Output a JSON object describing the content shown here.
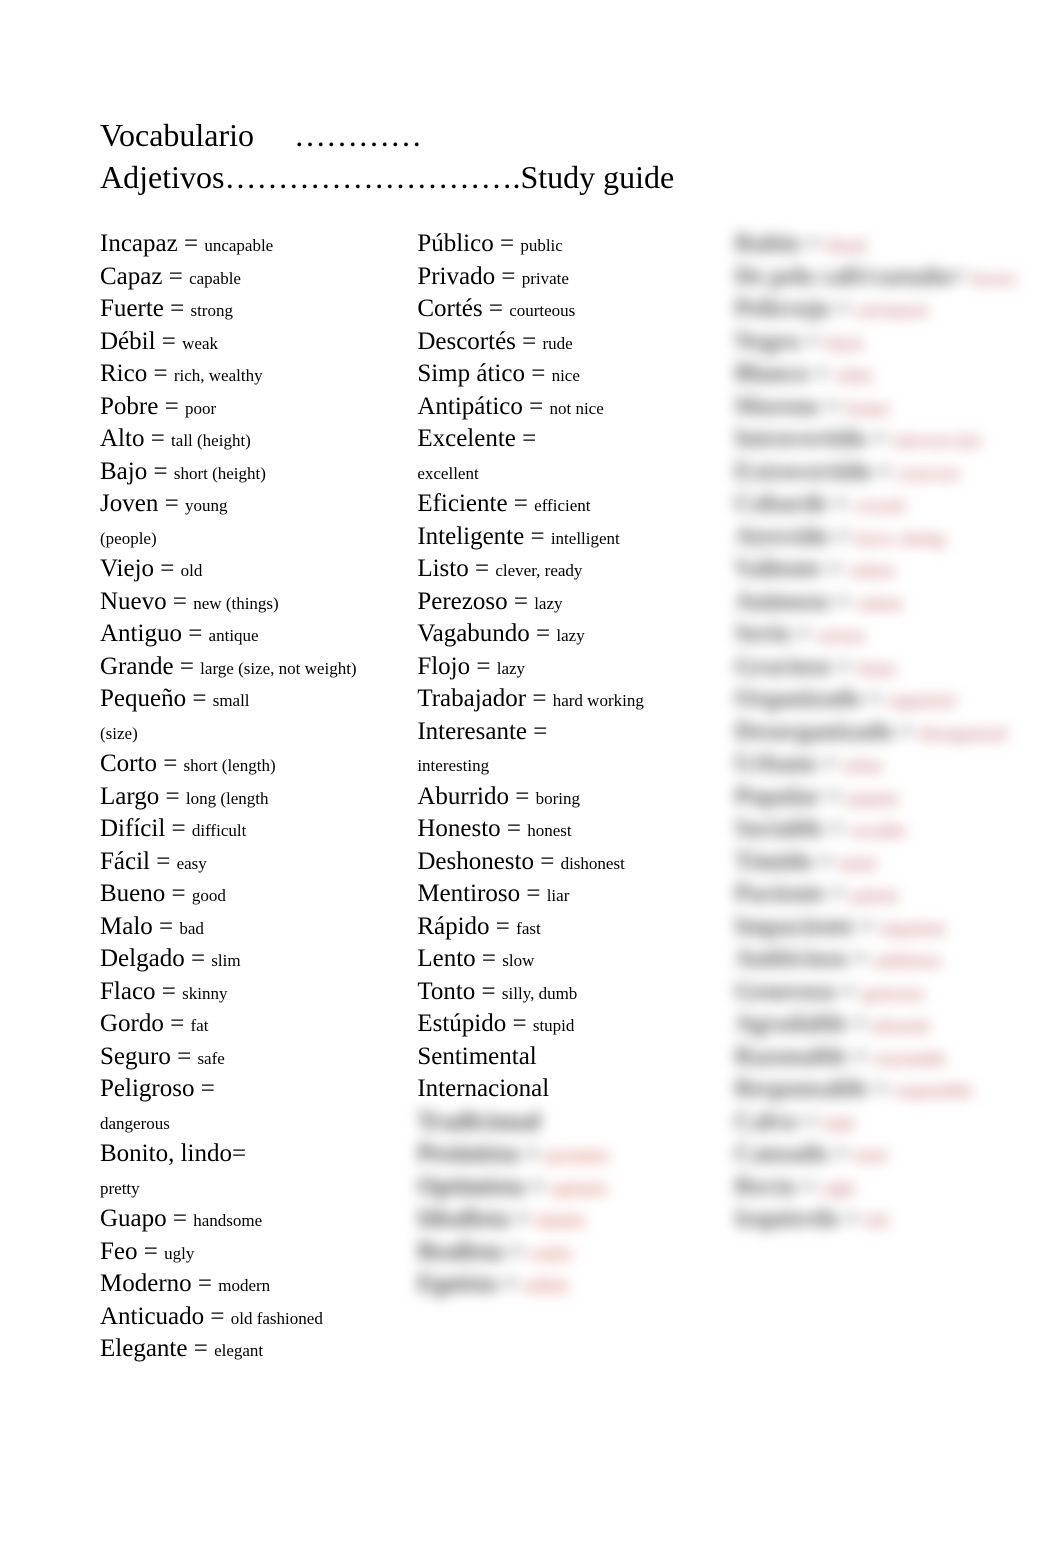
{
  "header": {
    "line1": "Vocabulario     …………",
    "line2": "Adjetivos……………………….Study guide"
  },
  "col1": [
    {
      "term": "Incapaz = ",
      "def": "uncapable"
    },
    {
      "term": "Capaz = ",
      "def": "capable"
    },
    {
      "term": "Fuerte = ",
      "def": "strong"
    },
    {
      "term": "Débil = ",
      "def": "weak"
    },
    {
      "term": "Rico = ",
      "def": "rich, wealthy"
    },
    {
      "term": "Pobre = ",
      "def": "poor"
    },
    {
      "term": "Alto = ",
      "def": "tall",
      "note": "   (height)"
    },
    {
      "term": "Bajo = ",
      "def": "short",
      "note": "   (height)"
    },
    {
      "term": "Joven = ",
      "def": "young",
      "note2": "(people)"
    },
    {
      "term": "Viejo = ",
      "def": "old"
    },
    {
      "term": "Nuevo = ",
      "def": "new",
      "note": "   (things)"
    },
    {
      "term": "Antiguo = ",
      "def": "antique"
    },
    {
      "term": "Grande = ",
      "def": "large",
      "note": "   (size, not weight)"
    },
    {
      "term": "Pequeño = ",
      "def": "small",
      "note2": "(size)"
    },
    {
      "term": "Corto = ",
      "def": "short (length)"
    },
    {
      "term": "Largo = ",
      "def": "long (length"
    },
    {
      "term": "Difícil = ",
      "def": "difficult"
    },
    {
      "term": "Fácil = ",
      "def": "easy"
    },
    {
      "term": "Bueno = ",
      "def": "good"
    },
    {
      "term": "Malo = ",
      "def": "bad"
    },
    {
      "term": "Delgado = ",
      "def": "slim"
    },
    {
      "term": "Flaco = ",
      "def": "skinny"
    },
    {
      "term": "Gordo = ",
      "def": "fat"
    },
    {
      "term": "Seguro = ",
      "def": "safe"
    },
    {
      "term": "Peligroso = ",
      "def": "",
      "note2": "dangerous"
    },
    {
      "term": "Bonito, lindo= ",
      "def": "",
      "note2": "pretty"
    },
    {
      "term": "Guapo = ",
      "def": "handsome"
    },
    {
      "term": "Feo = ",
      "def": "ugly"
    },
    {
      "term": "Moderno = ",
      "def": "modern"
    },
    {
      "term": "Anticuado = ",
      "def": "old fashioned"
    },
    {
      "term": "Elegante = ",
      "def": "elegant"
    }
  ],
  "col2_visible": [
    {
      "term": "Público = ",
      "def": "public"
    },
    {
      "term": "Privado = ",
      "def": "private"
    },
    {
      "term": "Cortés = ",
      "def": "courteous"
    },
    {
      "term": "Descortés = ",
      "def": "rude"
    },
    {
      "term": "Simp  ático = ",
      "def": "nice"
    },
    {
      "term": "Antipático = ",
      "def": "not nice"
    },
    {
      "term": "Excelente = ",
      "def": "",
      "note2": "excellent"
    },
    {
      "term": "Eficiente = ",
      "def": "efficient"
    },
    {
      "term": "Inteligente = ",
      "def": "intelligent"
    },
    {
      "term": "Listo = ",
      "def": "clever, ready"
    },
    {
      "term": "Perezoso = ",
      "def": "lazy"
    },
    {
      "term": "Vagabundo = ",
      "def": "lazy"
    },
    {
      "term": "Flojo = ",
      "def": "lazy"
    },
    {
      "term": "Trabajador = ",
      "def": "hard working"
    },
    {
      "term": "Interesante = ",
      "def": "",
      "note2": "interesting"
    },
    {
      "term": "Aburrido = ",
      "def": "boring"
    },
    {
      "term": "Honesto = ",
      "def": "honest"
    },
    {
      "term": "Deshonesto = ",
      "def": "dishonest"
    },
    {
      "term": "Mentiroso = ",
      "def": "liar"
    },
    {
      "term": "Rápido = ",
      "def": "fast"
    },
    {
      "term": "Lento = ",
      "def": "slow"
    },
    {
      "term": "Tonto = ",
      "def": "silly, dumb"
    },
    {
      "term": "Estúpido = ",
      "def": "stupid"
    },
    {
      "term": "Sentimental",
      "def": ""
    },
    {
      "term": "Internacional",
      "def": ""
    }
  ],
  "col2_blurred": [
    {
      "term": "Tradicional",
      "def": ""
    },
    {
      "term": "Pesimista = ",
      "def": "pessimist"
    },
    {
      "term": "Optimista = ",
      "def": "optimist"
    },
    {
      "term": "Idealista = ",
      "def": "idealist"
    },
    {
      "term": "Realista = ",
      "def": "realist"
    },
    {
      "term": "Egoísta = ",
      "def": "selfish"
    }
  ],
  "col3_blurred": [
    {
      "term": "Rubio = ",
      "def": "blond"
    },
    {
      "term": "De pelo café/castaño= ",
      "def": "brown"
    },
    {
      "term": "Pelirrojo = ",
      "def": "red-haired"
    },
    {
      "term": "Negro = ",
      "def": "black"
    },
    {
      "term": "Blanco = ",
      "def": "white"
    },
    {
      "term": "Moreno = ",
      "def": "brunet"
    },
    {
      "term": "Introvertido = ",
      "def": "introvert (in)"
    },
    {
      "term": "Extrovertido = ",
      "def": "extrovert"
    },
    {
      "term": "Cobarde = ",
      "def": "coward"
    },
    {
      "term": "Atrevido = ",
      "def": "brave, daring"
    },
    {
      "term": "Valiente = ",
      "def": "valient"
    },
    {
      "term": "Animoso = ",
      "def": "valient"
    },
    {
      "term": "Serio = ",
      "def": "serious"
    },
    {
      "term": "Gracioso = ",
      "def": "funny"
    },
    {
      "term": "Organizado = ",
      "def": "organized"
    },
    {
      "term": "Desorganizado = ",
      "def": "disorganized"
    },
    {
      "term": "Urbano = ",
      "def": "urban"
    },
    {
      "term": "Popular = ",
      "def": "popular"
    },
    {
      "term": "Sociable = ",
      "def": "sociable"
    },
    {
      "term": "Tímido = ",
      "def": "timid"
    },
    {
      "term": "Paciente = ",
      "def": "patient"
    },
    {
      "term": "Impaciente = ",
      "def": "impatient"
    },
    {
      "term": "Ambicioso = ",
      "def": "ambitious"
    },
    {
      "term": "Generoso = ",
      "def": "generous"
    },
    {
      "term": "Agradable = ",
      "def": "pleasant"
    },
    {
      "term": "Razonable = ",
      "def": "reasonable"
    },
    {
      "term": "Responsable = ",
      "def": "responsible"
    },
    {
      "term": "Calvo = ",
      "def": "bald"
    },
    {
      "term": "Cansado = ",
      "def": "tired"
    },
    {
      "term": "Recto = ",
      "def": "right"
    },
    {
      "term": "Izquierdo = ",
      "def": "left"
    }
  ]
}
